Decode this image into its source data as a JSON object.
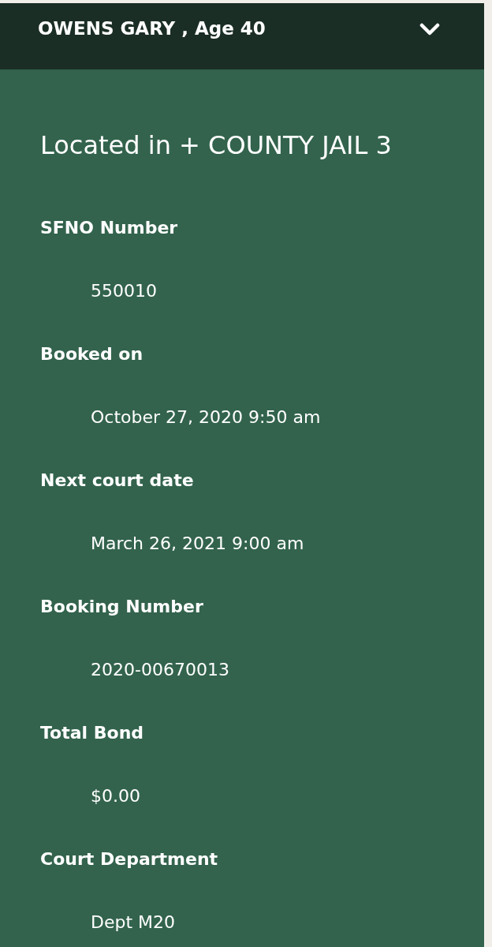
{
  "header": {
    "title": "OWENS GARY , Age 40",
    "expanded": true
  },
  "location": "Located in + COUNTY JAIL 3",
  "fields": [
    {
      "label": "SFNO Number",
      "value": "550010"
    },
    {
      "label": "Booked on",
      "value": "October 27, 2020 9:50 am"
    },
    {
      "label": "Next court date",
      "value": "March 26, 2021 9:00 am"
    },
    {
      "label": "Booking Number",
      "value": "2020-00670013"
    },
    {
      "label": "Total Bond",
      "value": "$0.00"
    },
    {
      "label": "Court Department",
      "value": "Dept M20"
    }
  ]
}
